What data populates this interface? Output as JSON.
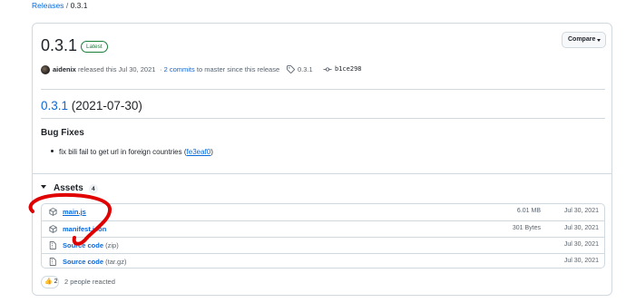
{
  "breadcrumb": {
    "link": "Releases",
    "separator": "/",
    "current": "0.3.1"
  },
  "release": {
    "title": "0.3.1",
    "badge": "Latest",
    "compare_label": "Compare",
    "author": "aidenix",
    "released_text": "released this Jul 30, 2021",
    "commits_link": "2 commits",
    "commits_text": "to master since this release",
    "tag": "0.3.1",
    "commit_sha": "b1ce298"
  },
  "notes": {
    "version_link": "0.3.1",
    "version_date": "(2021-07-30)",
    "section_title": "Bug Fixes",
    "items": [
      {
        "text": "fix bili fail to get url in foreign countries (",
        "link": "fe3eaf0",
        "suffix": ")"
      }
    ]
  },
  "assets": {
    "label": "Assets",
    "count": "4",
    "rows": [
      {
        "name": "main.js",
        "ext": "",
        "size": "6.01 MB",
        "date": "Jul 30, 2021",
        "icon": "package-icon"
      },
      {
        "name": "manifest.json",
        "ext": "",
        "size": "301 Bytes",
        "date": "Jul 30, 2021",
        "icon": "package-icon"
      },
      {
        "name": "Source code",
        "ext": "(zip)",
        "size": "",
        "date": "Jul 30, 2021",
        "icon": "file-zip-icon"
      },
      {
        "name": "Source code",
        "ext": "(tar.gz)",
        "size": "",
        "date": "Jul 30, 2021",
        "icon": "file-zip-icon"
      }
    ]
  },
  "reactions": {
    "emoji": "👍",
    "count": "2",
    "text": "2 people reacted"
  },
  "colors": {
    "link": "#0969da",
    "badge": "#1a7f37",
    "annotation": "#e00000",
    "border": "#d1d9e0"
  }
}
